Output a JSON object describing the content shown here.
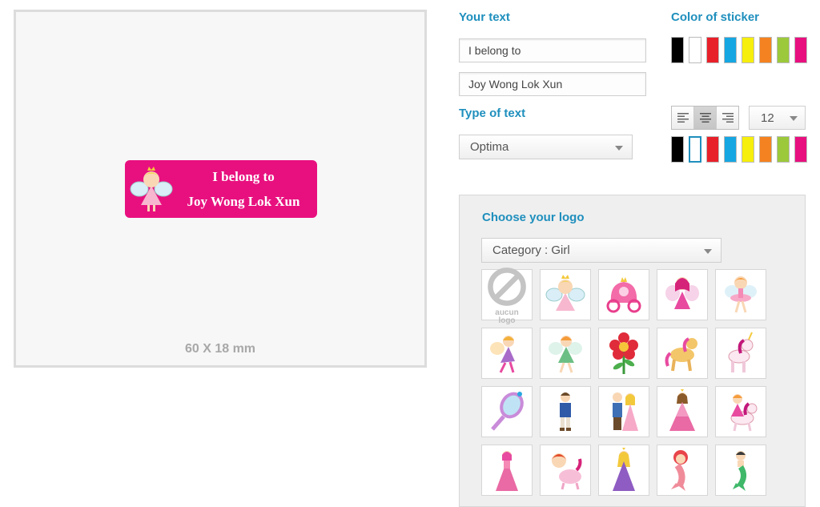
{
  "preview": {
    "sticker_line1": "I belong to",
    "sticker_line2": "Joy Wong Lok Xun",
    "sticker_color": "#e8107f",
    "sticker_logo_icon": "fairy-icon",
    "size_label": "60 X 18 mm"
  },
  "your_text": {
    "heading": "Your text",
    "line1_value": "I belong to",
    "line2_value": "Joy Wong Lok Xun"
  },
  "type_of_text": {
    "heading": "Type of text",
    "font_selected": "Optima",
    "alignment_selected": "center",
    "font_size_selected": "12"
  },
  "sticker_color": {
    "heading": "Color of sticker",
    "swatches": [
      "#000000",
      "#ffffff",
      "#e8202a",
      "#16a6e2",
      "#f6ee0c",
      "#f58220",
      "#9cc93b",
      "#e8107f"
    ],
    "selected": "#e8107f"
  },
  "text_color": {
    "swatches": [
      "#000000",
      "#ffffff",
      "#e8202a",
      "#16a6e2",
      "#f6ee0c",
      "#f58220",
      "#9cc93b",
      "#e8107f"
    ],
    "selected": "#ffffff"
  },
  "logo": {
    "heading": "Choose your logo",
    "category_select": "Category : Girl",
    "no_logo_text": "aucun logo",
    "items": [
      "no-logo-icon",
      "fairy-icon",
      "carriage-icon",
      "fairy-pink-icon",
      "ballerina-fairy-icon",
      "fairy-purple-icon",
      "fairy-green-icon",
      "flower-icon",
      "horse-icon",
      "unicorn-icon",
      "mirror-icon",
      "prince-icon",
      "prince-princess-icon",
      "princess-pink-icon",
      "princess-unicorn-icon",
      "princess-icon",
      "girl-pony-icon",
      "princess-purple-icon",
      "mermaid-red-icon",
      "mermaid-green-icon"
    ]
  }
}
